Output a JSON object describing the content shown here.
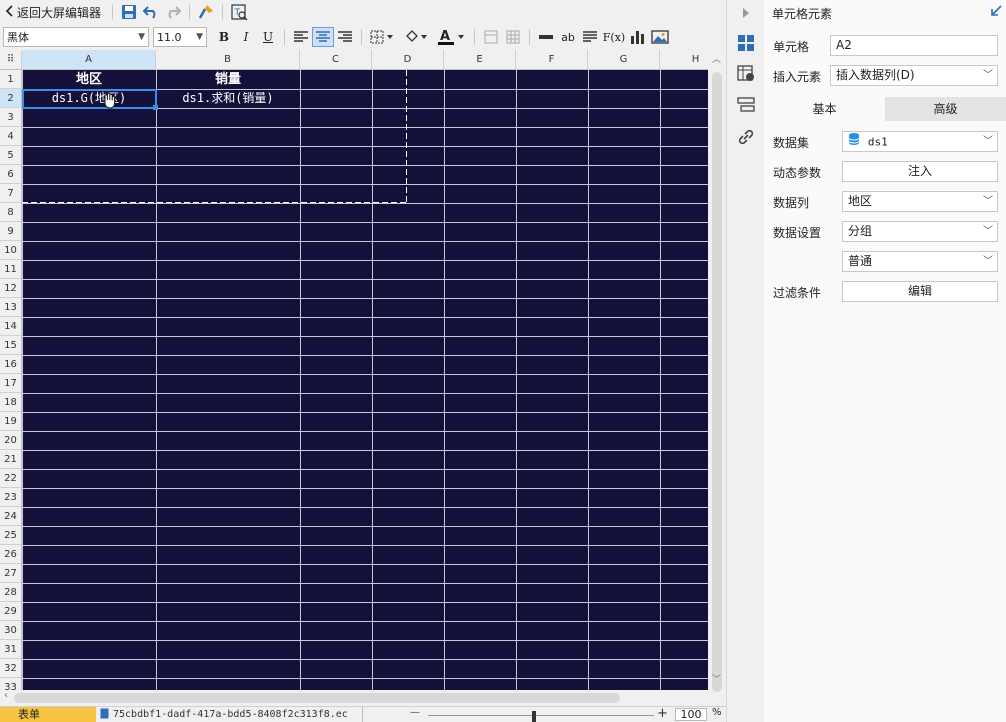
{
  "toolbar": {
    "back_label": "返回大屏编辑器",
    "font_name": "黑体",
    "font_size": "11.0",
    "bold": "B",
    "italic": "I",
    "underline": "U",
    "fx": "F(x)",
    "ab": "ab"
  },
  "sheet": {
    "columns": [
      "A",
      "B",
      "C",
      "D",
      "E",
      "F",
      "G",
      "H"
    ],
    "rows": [
      "1",
      "2",
      "3",
      "4",
      "5",
      "6",
      "7",
      "8",
      "9",
      "10",
      "11",
      "12",
      "13",
      "14",
      "15",
      "16",
      "17",
      "18",
      "19",
      "20",
      "21",
      "22",
      "23",
      "24",
      "25",
      "26",
      "27",
      "28",
      "29",
      "30",
      "31",
      "32",
      "33"
    ],
    "selected_cell": "A2",
    "background": "#13103a",
    "cells": {
      "a1": "地区",
      "b1": "销量",
      "a2": "ds1.G(地区)",
      "b2": "ds1.求和(销量)"
    }
  },
  "bottom": {
    "sheet_tab": "表单",
    "file_name": "75cbdbf1-dadf-417a-bdd5-8408f2c313f8.ec",
    "zoom_minus": "—",
    "zoom_plus": "+",
    "zoom_value": "100",
    "zoom_unit": "%"
  },
  "panel": {
    "title": "单元格元素",
    "cell_label": "单元格",
    "cell_value": "A2",
    "insert_label": "插入元素",
    "insert_value": "插入数据列(D)",
    "tab_basic": "基本",
    "tab_advanced": "高级",
    "dataset_label": "数据集",
    "dataset_value": "ds1",
    "dyn_param_label": "动态参数",
    "dyn_param_btn": "注入",
    "datacol_label": "数据列",
    "datacol_value": "地区",
    "dataset_setting_label": "数据设置",
    "setting_value": "分组",
    "setting_mode": "普通",
    "filter_label": "过滤条件",
    "filter_btn": "编辑"
  }
}
